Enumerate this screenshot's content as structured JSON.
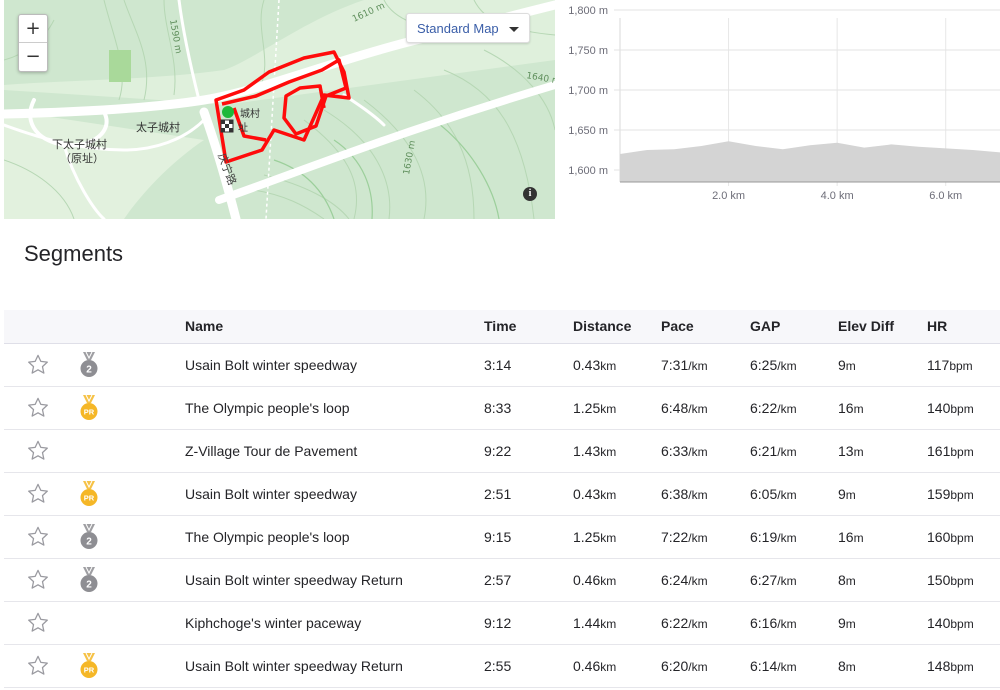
{
  "map": {
    "zoom_in_label": "+",
    "zoom_out_label": "−",
    "map_type_label": "Standard Map",
    "info_label": "i",
    "place_labels": [
      "太子城村",
      "下太子城村",
      "（原址）",
      "庆宁路",
      "1610 m",
      "1590 m",
      "1640 m",
      "1630 m",
      "城村",
      "址"
    ]
  },
  "elevation": {
    "chart_data": {
      "type": "area",
      "x": [
        0.0,
        0.5,
        1.0,
        1.5,
        2.0,
        2.5,
        3.0,
        3.5,
        4.0,
        4.5,
        5.0,
        5.5,
        6.0,
        6.5,
        7.0
      ],
      "y": [
        1620,
        1625,
        1626,
        1630,
        1636,
        1630,
        1626,
        1631,
        1634,
        1628,
        1632,
        1629,
        1627,
        1625,
        1622
      ],
      "ylim": [
        1585,
        1800
      ],
      "xlim": [
        0,
        7.0
      ],
      "yticks": [
        "1,800 m",
        "1,750 m",
        "1,700 m",
        "1,650 m",
        "1,600 m"
      ],
      "ytick_values": [
        1800,
        1750,
        1700,
        1650,
        1600
      ],
      "xticks": [
        "2.0 km",
        "4.0 km",
        "6.0 km"
      ],
      "xtick_values": [
        2.0,
        4.0,
        6.0
      ],
      "grid": true,
      "fill_color": "#d4d4d4"
    }
  },
  "segments": {
    "title": "Segments",
    "headers": {
      "name": "Name",
      "time": "Time",
      "distance": "Distance",
      "pace": "Pace",
      "gap": "GAP",
      "elev_diff": "Elev Diff",
      "hr": "HR"
    },
    "rows": [
      {
        "medal": "2",
        "name": "Usain Bolt winter speedway",
        "time": "3:14",
        "distance": "0.43",
        "distance_unit": "km",
        "pace": "7:31",
        "pace_unit": "/km",
        "gap": "6:25",
        "gap_unit": "/km",
        "elev": "9",
        "elev_unit": "m",
        "hr": "117",
        "hr_unit": "bpm"
      },
      {
        "medal": "PR",
        "name": "The Olympic people's loop",
        "time": "8:33",
        "distance": "1.25",
        "distance_unit": "km",
        "pace": "6:48",
        "pace_unit": "/km",
        "gap": "6:22",
        "gap_unit": "/km",
        "elev": "16",
        "elev_unit": "m",
        "hr": "140",
        "hr_unit": "bpm"
      },
      {
        "medal": "",
        "name": "Z-Village Tour de Pavement",
        "time": "9:22",
        "distance": "1.43",
        "distance_unit": "km",
        "pace": "6:33",
        "pace_unit": "/km",
        "gap": "6:21",
        "gap_unit": "/km",
        "elev": "13",
        "elev_unit": "m",
        "hr": "161",
        "hr_unit": "bpm"
      },
      {
        "medal": "PR",
        "name": "Usain Bolt winter speedway",
        "time": "2:51",
        "distance": "0.43",
        "distance_unit": "km",
        "pace": "6:38",
        "pace_unit": "/km",
        "gap": "6:05",
        "gap_unit": "/km",
        "elev": "9",
        "elev_unit": "m",
        "hr": "159",
        "hr_unit": "bpm"
      },
      {
        "medal": "2",
        "name": "The Olympic people's loop",
        "time": "9:15",
        "distance": "1.25",
        "distance_unit": "km",
        "pace": "7:22",
        "pace_unit": "/km",
        "gap": "6:19",
        "gap_unit": "/km",
        "elev": "16",
        "elev_unit": "m",
        "hr": "160",
        "hr_unit": "bpm"
      },
      {
        "medal": "2",
        "name": "Usain Bolt winter speedway Return",
        "time": "2:57",
        "distance": "0.46",
        "distance_unit": "km",
        "pace": "6:24",
        "pace_unit": "/km",
        "gap": "6:27",
        "gap_unit": "/km",
        "elev": "8",
        "elev_unit": "m",
        "hr": "150",
        "hr_unit": "bpm"
      },
      {
        "medal": "",
        "name": "Kiphchoge's winter paceway",
        "time": "9:12",
        "distance": "1.44",
        "distance_unit": "km",
        "pace": "6:22",
        "pace_unit": "/km",
        "gap": "6:16",
        "gap_unit": "/km",
        "elev": "9",
        "elev_unit": "m",
        "hr": "140",
        "hr_unit": "bpm"
      },
      {
        "medal": "PR",
        "name": "Usain Bolt winter speedway Return",
        "time": "2:55",
        "distance": "0.46",
        "distance_unit": "km",
        "pace": "6:20",
        "pace_unit": "/km",
        "gap": "6:14",
        "gap_unit": "/km",
        "elev": "8",
        "elev_unit": "m",
        "hr": "148",
        "hr_unit": "bpm"
      }
    ],
    "colors": {
      "silver": "#8e8e93",
      "gold": "#f5b727",
      "star": "#9a9aa0"
    }
  }
}
